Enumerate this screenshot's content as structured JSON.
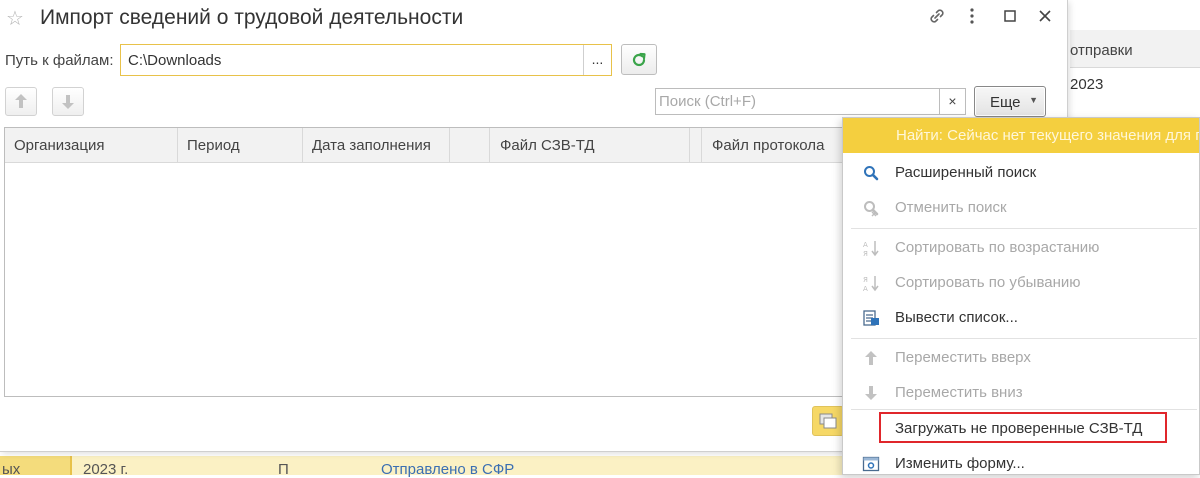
{
  "background": {
    "column_header": "отправки",
    "column_value": "2023",
    "row": {
      "c1": "ых",
      "c2": "2023 г.",
      "c3": "П",
      "c4": "Отправлено в СФР"
    }
  },
  "dialog": {
    "title": "Импорт сведений о трудовой деятельности",
    "path": {
      "label": "Путь к файлам:",
      "value": "C:\\Downloads",
      "browse_label": "..."
    },
    "search": {
      "placeholder": "Поиск (Ctrl+F)",
      "clear_label": "×"
    },
    "more_label": "Еще",
    "table": {
      "columns": [
        "Организация",
        "Период",
        "Дата заполнения",
        "",
        "Файл СЗВ-ТД",
        "",
        "Файл протокола"
      ]
    }
  },
  "menu": {
    "items": [
      {
        "label": "Найти: Сейчас нет текущего значения для поиска",
        "state": "highlighted"
      },
      {
        "label": "Расширенный поиск",
        "icon": "search-icon",
        "state": "enabled"
      },
      {
        "label": "Отменить поиск",
        "icon": "cancel-search-icon",
        "state": "disabled"
      },
      {
        "label": "Сортировать по возрастанию",
        "icon": "sort-ascending-icon",
        "state": "disabled"
      },
      {
        "label": "Сортировать по убыванию",
        "icon": "sort-descending-icon",
        "state": "disabled"
      },
      {
        "label": "Вывести список...",
        "icon": "output-list-icon",
        "state": "enabled"
      },
      {
        "label": "Переместить вверх",
        "icon": "arrow-up-icon",
        "state": "disabled"
      },
      {
        "label": "Переместить вниз",
        "icon": "arrow-down-icon",
        "state": "disabled"
      },
      {
        "label": "Загружать не проверенные СЗВ-ТД",
        "state": "enabled",
        "annotated": true
      },
      {
        "label": "Изменить форму...",
        "icon": "change-form-icon",
        "state": "enabled"
      }
    ]
  },
  "colors": {
    "accent_yellow": "#f4cf3f",
    "annotation_red": "#e0262b",
    "link_blue": "#3b6fb2",
    "refresh_green": "#3aa44a"
  }
}
